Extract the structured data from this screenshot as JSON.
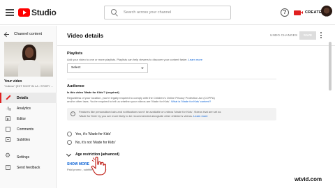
{
  "app": {
    "logo_text": "Studio",
    "brand_color": "#ff0000"
  },
  "search": {
    "placeholder": "Search across your channel"
  },
  "header": {
    "help_symbol": "?",
    "create_label": "CREATE"
  },
  "sidebar": {
    "back_label": "Channel content",
    "your_video_label": "Your video",
    "video_title": "\"Jollene\" (EXT SHOT IN LA : STORY ...",
    "items": [
      {
        "label": "Details",
        "icon": "pencil-icon",
        "active": true
      },
      {
        "label": "Analytics",
        "icon": "analytics-icon",
        "active": false
      },
      {
        "label": "Editor",
        "icon": "editor-icon",
        "active": false
      },
      {
        "label": "Comments",
        "icon": "comments-icon",
        "active": false
      },
      {
        "label": "Subtitles",
        "icon": "subtitles-icon",
        "active": false
      }
    ],
    "bottom_items": [
      {
        "label": "Settings",
        "icon": "gear-icon"
      },
      {
        "label": "Send feedback",
        "icon": "feedback-icon"
      }
    ]
  },
  "main": {
    "title": "Video details",
    "undo_label": "UNDO CHANGES",
    "save_label": "SAVE",
    "playlists": {
      "heading": "Playlists",
      "description": "Add your video to one or more playlists. Playlists can help viewers to discover your content faster.",
      "learn_more": "Learn more",
      "select_value": "Select"
    },
    "audience": {
      "heading": "Audience",
      "question": "Is this video 'Made for Kids'? (required)",
      "description_line1": "Regardless of your location, you're legally required to comply with the Children's Online Privacy Protection Act (COPPA)",
      "description_line2": "and/or other laws. You're required to tell us whether your videos are 'Made for Kids'.",
      "what_is_link": "What is 'Made for Kids' content?",
      "notice_line1": "Features like personalised ads and notifications won't be available on videos 'Made for Kids'. Videos that are set as",
      "notice_line2": "'Made for Kids' by you are more likely to be recommended alongside other children's videos.",
      "notice_learn_more": "Learn more",
      "option_yes": "Yes, it's 'Made for Kids'",
      "option_no": "No, it's not 'Made for Kids'"
    },
    "age_restriction": {
      "label": "Age restriction (advanced)"
    },
    "show_more": "SHOW MORE",
    "paid_promotion_text": "Paid promo                , subtitles and more"
  },
  "watermark": "wtvid.com"
}
